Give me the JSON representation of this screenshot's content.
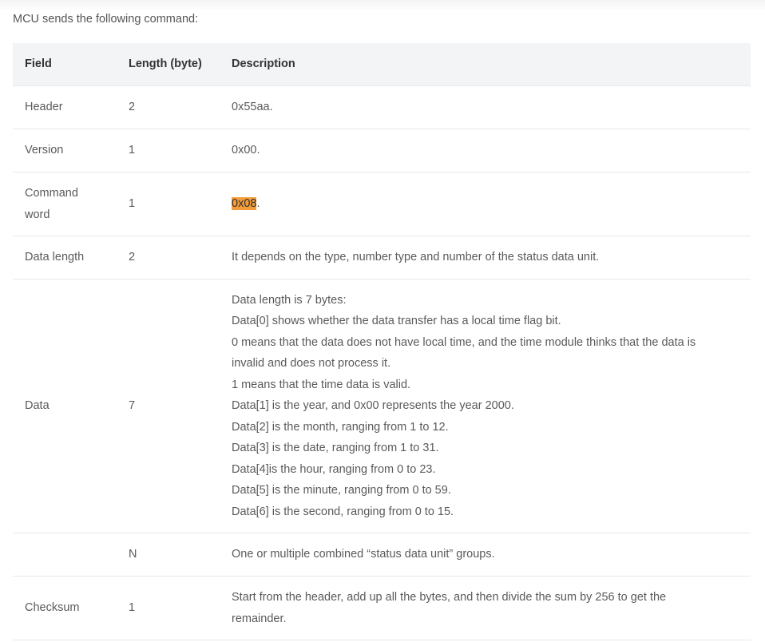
{
  "intro": "MCU sends the following command:",
  "table": {
    "headers": [
      "Field",
      "Length (byte)",
      "Description"
    ],
    "rows": {
      "header": {
        "field": "Header",
        "length": "2",
        "desc": "0x55aa."
      },
      "version": {
        "field": "Version",
        "length": "1",
        "desc": "0x00."
      },
      "command": {
        "field_line1": "Command",
        "field_line2": "word",
        "length": "1",
        "desc_highlight": "0x08",
        "desc_suffix": "."
      },
      "dlen": {
        "field": "Data length",
        "length": "2",
        "desc": "It depends on the type, number type and number of the status data unit."
      },
      "data": {
        "field": "Data",
        "length": "7",
        "lines": [
          "Data length is 7 bytes:",
          "Data[0] shows whether the data transfer has a local time flag bit.",
          "0 means that the data does not have local time, and the time module thinks that the data is",
          "invalid and does not process it.",
          "1 means that the time data is valid.",
          "Data[1] is the year, and 0x00 represents the year 2000.",
          "Data[2] is the month, ranging from 1 to 12.",
          "Data[3] is the date, ranging from 1 to 31.",
          "Data[4]is the hour, ranging from 0 to 23.",
          "Data[5] is the minute, ranging from 0 to 59.",
          "Data[6] is the second, ranging from 0 to 15."
        ]
      },
      "units": {
        "field": "",
        "length": "N",
        "desc": "One or multiple combined “status data unit” groups."
      },
      "checksum": {
        "field": "Checksum",
        "length": "1",
        "desc_line1": "Start from the header, add up all the bytes, and then divide the sum by 256 to get the",
        "desc_line2": "remainder."
      }
    }
  },
  "colors": {
    "highlight": "#f29b3a",
    "header_bg": "#f3f4f6",
    "border": "#e8e8e8"
  }
}
